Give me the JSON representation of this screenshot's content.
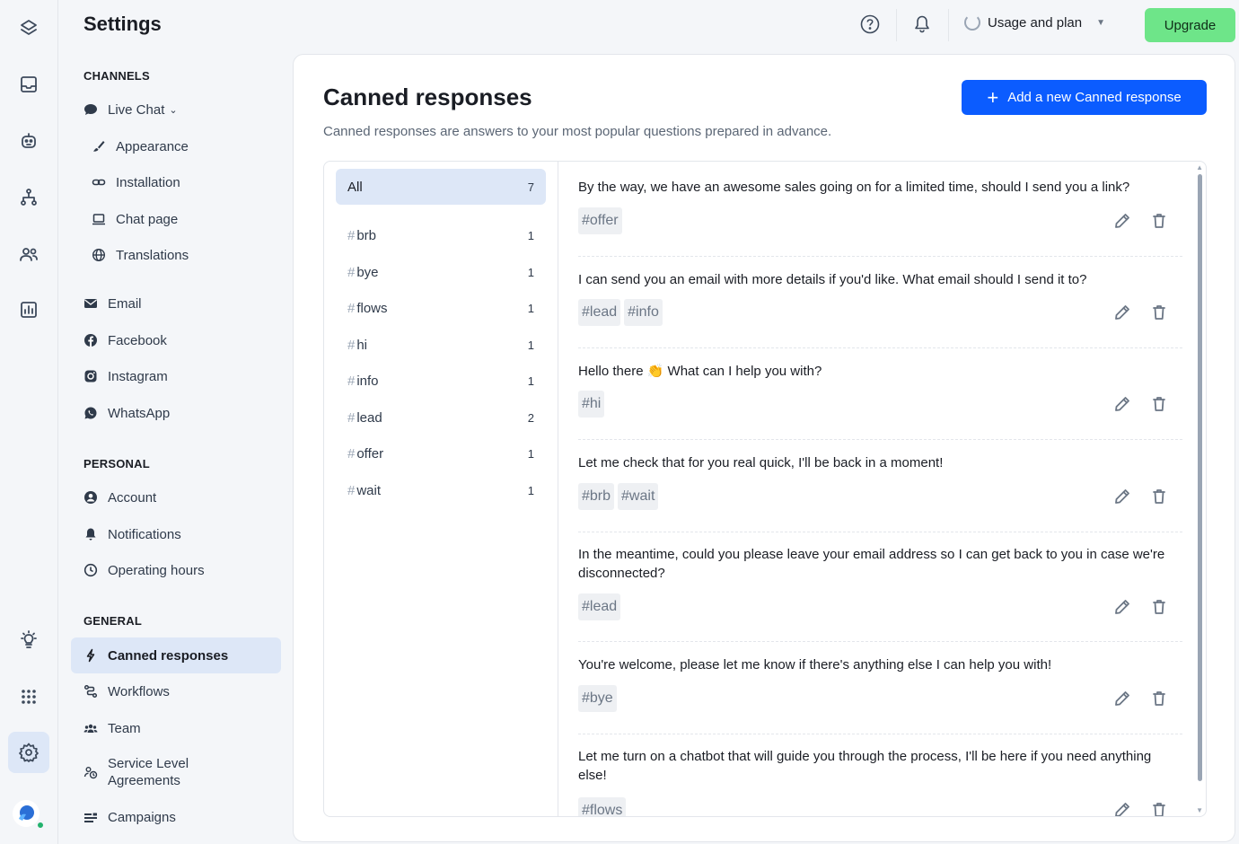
{
  "header": {
    "title": "Settings",
    "usage_label": "Usage and plan",
    "upgrade_label": "Upgrade"
  },
  "sidebar": {
    "channels_label": "CHANNELS",
    "live_chat": "Live Chat",
    "live_chat_items": [
      {
        "label": "Appearance",
        "icon": "brush-icon"
      },
      {
        "label": "Installation",
        "icon": "link-icon"
      },
      {
        "label": "Chat page",
        "icon": "laptop-icon"
      },
      {
        "label": "Translations",
        "icon": "globe-icon"
      }
    ],
    "channel_items": [
      {
        "label": "Email",
        "icon": "mail-icon"
      },
      {
        "label": "Facebook",
        "icon": "facebook-icon"
      },
      {
        "label": "Instagram",
        "icon": "instagram-icon"
      },
      {
        "label": "WhatsApp",
        "icon": "whatsapp-icon"
      }
    ],
    "personal_label": "PERSONAL",
    "personal_items": [
      {
        "label": "Account",
        "icon": "user-icon"
      },
      {
        "label": "Notifications",
        "icon": "bell-icon"
      },
      {
        "label": "Operating hours",
        "icon": "clock-icon"
      }
    ],
    "general_label": "GENERAL",
    "general_items": [
      {
        "label": "Canned responses",
        "icon": "bolt-icon",
        "active": true
      },
      {
        "label": "Workflows",
        "icon": "workflow-icon"
      },
      {
        "label": "Team",
        "icon": "team-icon"
      },
      {
        "label": "Service Level Agreements",
        "icon": "sla-icon"
      },
      {
        "label": "Campaigns",
        "icon": "campaign-icon"
      }
    ]
  },
  "main": {
    "title": "Canned responses",
    "subtitle": "Canned responses are answers to your most popular questions prepared in advance.",
    "add_button": "Add a new Canned response",
    "filters": [
      {
        "name": "All",
        "count": "7",
        "hash": false
      },
      {
        "name": "brb",
        "count": "1",
        "hash": true
      },
      {
        "name": "bye",
        "count": "1",
        "hash": true
      },
      {
        "name": "flows",
        "count": "1",
        "hash": true
      },
      {
        "name": "hi",
        "count": "1",
        "hash": true
      },
      {
        "name": "info",
        "count": "1",
        "hash": true
      },
      {
        "name": "lead",
        "count": "2",
        "hash": true
      },
      {
        "name": "offer",
        "count": "1",
        "hash": true
      },
      {
        "name": "wait",
        "count": "1",
        "hash": true
      }
    ],
    "responses": [
      {
        "text": "By the way, we have an awesome sales going on for a limited time, should I send you a link?",
        "tags": [
          "#offer"
        ]
      },
      {
        "text": "I can send you an email with more details if you'd like. What email should I send it to?",
        "tags": [
          "#lead",
          "#info"
        ]
      },
      {
        "text": "Hello there 👏 What can I help you with?",
        "tags": [
          "#hi"
        ]
      },
      {
        "text": "Let me check that for you real quick, I'll be back in a moment!",
        "tags": [
          "#brb",
          "#wait"
        ]
      },
      {
        "text": "In the meantime, could you please leave your email address so I can get back to you in case we're disconnected?",
        "tags": [
          "#lead"
        ]
      },
      {
        "text": "You're welcome, please let me know if there's anything else I can help you with!",
        "tags": [
          "#bye"
        ]
      },
      {
        "text": "Let me turn on a chatbot that will guide you through the process, I'll be here if you need anything else!",
        "tags": [
          "#flows"
        ]
      }
    ]
  },
  "colors": {
    "accent": "#0b5cff",
    "upgrade": "#6ee589",
    "active_bg": "#dde7f7"
  }
}
